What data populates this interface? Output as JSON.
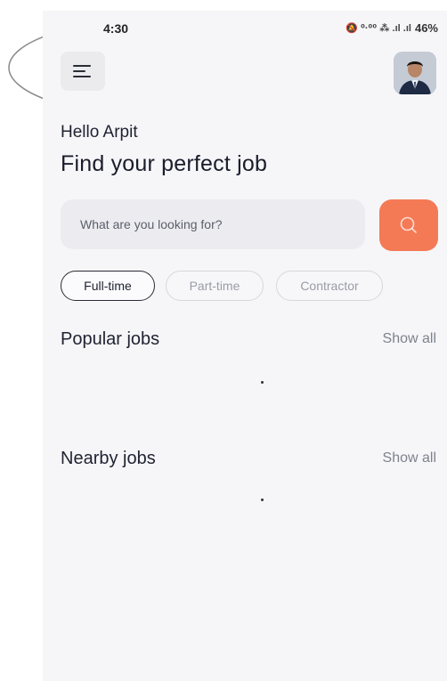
{
  "status_bar": {
    "time": "4:30",
    "icons_text": "🔕 ⁰·⁰⁰ ⁂ .ıl .ıl",
    "battery": "46%"
  },
  "header": {
    "menu_icon": "hamburger-menu-icon",
    "avatar": "user-avatar"
  },
  "greeting": {
    "hello": "Hello Arpit",
    "headline": "Find your perfect job"
  },
  "search": {
    "placeholder": "What are you looking for?",
    "button_icon": "search-icon"
  },
  "filters": {
    "chips": [
      {
        "label": "Full-time",
        "active": true
      },
      {
        "label": "Part-time",
        "active": false
      },
      {
        "label": "Contractor",
        "active": false
      }
    ]
  },
  "sections": {
    "popular": {
      "title": "Popular jobs",
      "show_all": "Show all"
    },
    "nearby": {
      "title": "Nearby jobs",
      "show_all": "Show all"
    }
  },
  "colors": {
    "accent": "#f47a55",
    "background": "#f6f6f9",
    "text_dark": "#1f2230",
    "text_muted": "#7f828d"
  }
}
